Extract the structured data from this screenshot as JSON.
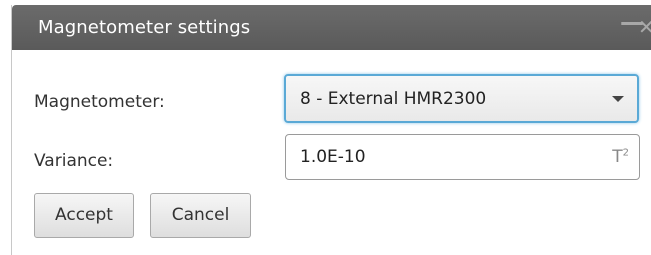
{
  "window": {
    "title": "Magnetometer settings",
    "controls": {
      "minimize": "—",
      "close": "✕"
    }
  },
  "form": {
    "magnetometer": {
      "label": "Magnetometer:",
      "selected": "8 - External HMR2300"
    },
    "variance": {
      "label": "Variance:",
      "value": "1.0E-10",
      "unit": "T",
      "unit_exponent": "2"
    }
  },
  "buttons": {
    "accept": "Accept",
    "cancel": "Cancel"
  },
  "colors": {
    "titlebar": "#5f5f5f",
    "focus_border": "#5aa9d6"
  }
}
